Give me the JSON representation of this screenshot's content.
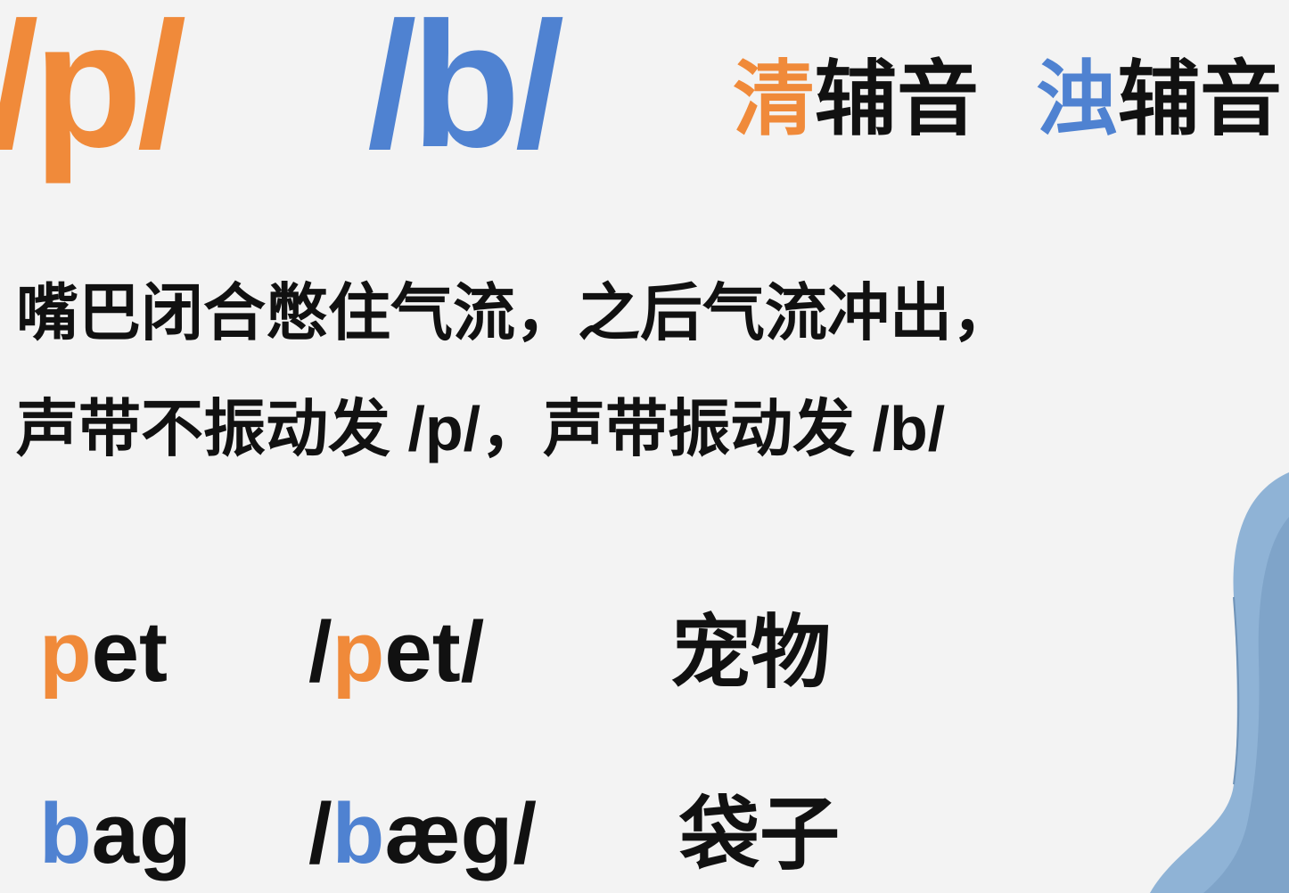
{
  "colors": {
    "voiceless": "#f08a3a",
    "voiced": "#4f82d1",
    "text": "#111111",
    "background": "#f3f3f3"
  },
  "phonemes": {
    "voiceless": "/p/",
    "voiced": "/b/"
  },
  "categories": {
    "voiceless": {
      "highlight": "清",
      "rest": "辅音"
    },
    "voiced": {
      "highlight": "浊",
      "rest": "辅音"
    }
  },
  "explanation": {
    "line1": "嘴巴闭合憋住气流，之后气流冲出，",
    "line2": "声带不振动发 /p/，声带振动发 /b/"
  },
  "examples": [
    {
      "word_highlight": "p",
      "word_rest": "et",
      "ipa_open": "/",
      "ipa_highlight": "p",
      "ipa_rest": "et/",
      "meaning": "宠物"
    },
    {
      "word_highlight": "b",
      "word_rest": "ag",
      "ipa_open": "/",
      "ipa_highlight": "b",
      "ipa_rest": "æg/",
      "meaning": "袋子"
    }
  ],
  "presenter": {
    "icon": "person-silhouette",
    "shirt_color": "#8fb3d6"
  }
}
